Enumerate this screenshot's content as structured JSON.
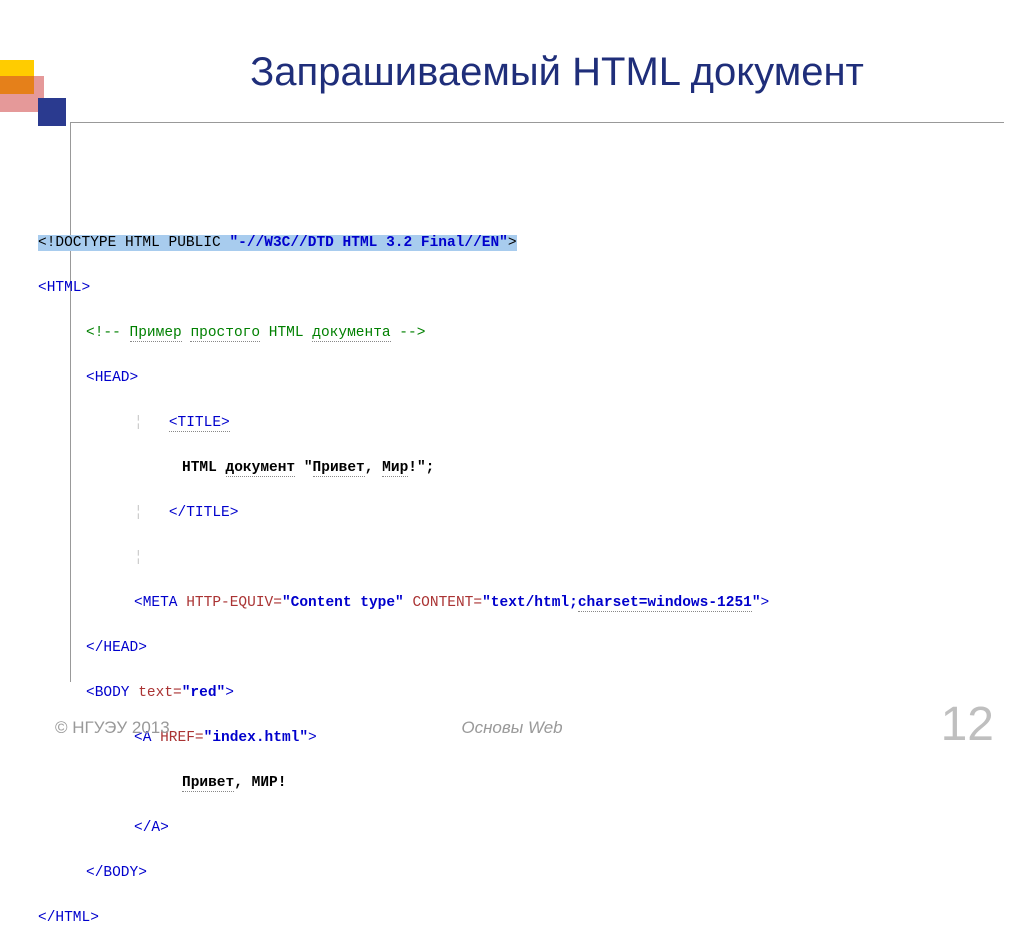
{
  "title": "Запрашиваемый HTML документ",
  "code": {
    "doctype_pre": "<!DOCTYPE HTML PUBLIC ",
    "doctype_str": "\"-//W3C//DTD HTML 3.2 Final//EN\"",
    "doctype_post": ">",
    "html_open": "<HTML>",
    "comment": "<!-- Пример простого HTML документа -->",
    "head_open": "<HEAD>",
    "title_open": "<TITLE>",
    "title_text": "HTML документ \"Привет, Мир!\";",
    "title_close": "</TITLE>",
    "meta_open": "<META",
    "meta_attr1": " HTTP-EQUIV=",
    "meta_val1": "\"Content type\"",
    "meta_attr2": " CONTENT=",
    "meta_val2a": "\"text/html;",
    "meta_val2b": "charset=windows-1251",
    "meta_val2c": "\"",
    "meta_close": ">",
    "head_close": "</HEAD>",
    "body_open": "<BODY",
    "body_attr": " text=",
    "body_val": "\"red\"",
    "body_close": ">",
    "a_open": "<A",
    "a_attr": " HREF=",
    "a_val": "\"index.html\"",
    "a_close": ">",
    "a_text1": "Привет",
    "a_text2": ", МИР!",
    "a_tag_close": "</A>",
    "body_tag_close": "</BODY>",
    "html_close": "</HTML>"
  },
  "footer": {
    "left": "© НГУЭУ 2013",
    "center": "Основы Web",
    "page": "12"
  }
}
